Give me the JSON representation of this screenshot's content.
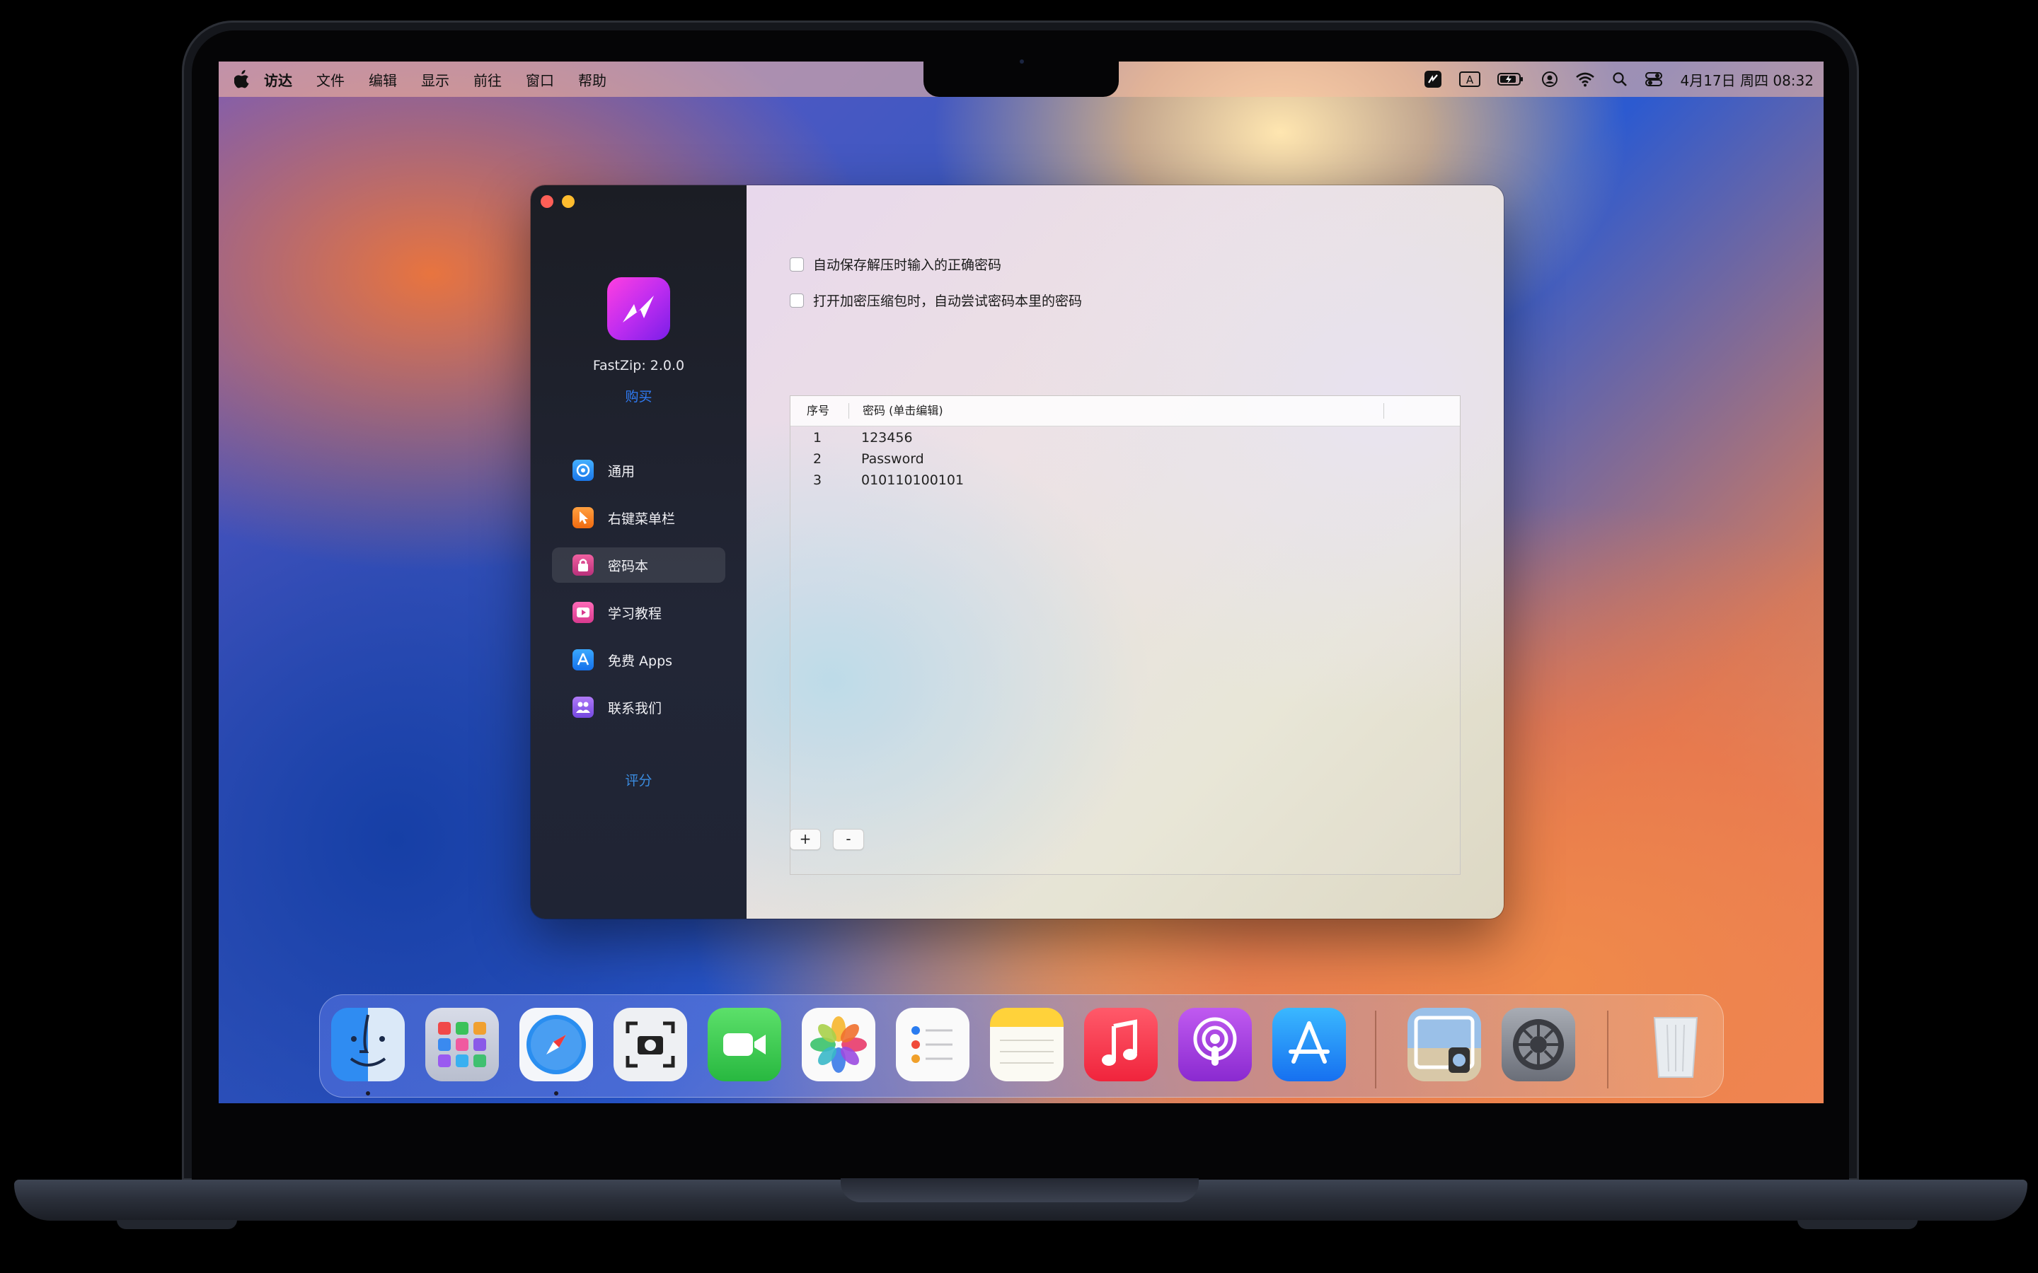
{
  "menubar": {
    "apple": "",
    "app_name": "访达",
    "items": [
      "文件",
      "编辑",
      "显示",
      "前往",
      "窗口",
      "帮助"
    ],
    "clock": "4月17日 周四 08:32"
  },
  "app": {
    "name_version": "FastZip: 2.0.0",
    "buy_label": "购买",
    "rate_label": "评分",
    "sidebar": [
      {
        "label": "通用",
        "icon": "gear-icon",
        "color": "#2a8cf0"
      },
      {
        "label": "右键菜单栏",
        "icon": "cursor-icon",
        "color": "#f07a20"
      },
      {
        "label": "密码本",
        "icon": "lock-icon",
        "color": "#d0408a",
        "active": true
      },
      {
        "label": "学习教程",
        "icon": "play-icon",
        "color": "#e04aa0"
      },
      {
        "label": "免费 Apps",
        "icon": "appstore-icon",
        "color": "#1f8af5"
      },
      {
        "label": "联系我们",
        "icon": "people-icon",
        "color": "#8a5ae8"
      }
    ],
    "options": [
      {
        "label": "自动保存解压时输入的正确密码",
        "checked": false
      },
      {
        "label": "打开加密压缩包时，自动尝试密码本里的密码",
        "checked": false
      }
    ],
    "table": {
      "headers": [
        "序号",
        "密码 (单击编辑)"
      ],
      "rows": [
        {
          "index": "1",
          "password": "123456"
        },
        {
          "index": "2",
          "password": "Password"
        },
        {
          "index": "3",
          "password": "010110100101"
        }
      ]
    },
    "add_label": "+",
    "remove_label": "-"
  },
  "dock": [
    "finder-icon",
    "launchpad-icon",
    "safari-icon",
    "screenshot-icon",
    "facetime-icon",
    "photos-icon",
    "reminders-icon",
    "notes-icon",
    "music-icon",
    "podcasts-icon",
    "appstore-icon",
    "preview-icon",
    "system-settings-icon",
    "trash-icon"
  ]
}
